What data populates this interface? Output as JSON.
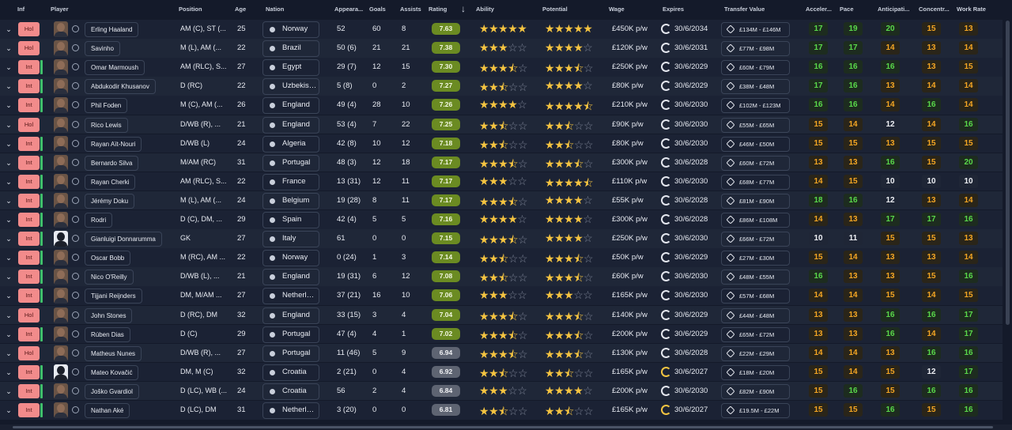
{
  "headers": {
    "inf": "Inf",
    "player": "Player",
    "position": "Position",
    "age": "Age",
    "nation": "Nation",
    "appearances": "Appeara...",
    "goals": "Goals",
    "assists": "Assists",
    "rating": "Rating",
    "sort_icon": "down-arrow-icon",
    "ability": "Ability",
    "potential": "Potential",
    "wage": "Wage",
    "expires": "Expires",
    "transfer_value": "Transfer Value",
    "acceleration": "Acceler...",
    "pace": "Pace",
    "anticipation": "Anticipati...",
    "concentration": "Concentr...",
    "work_rate": "Work Rate"
  },
  "colors": {
    "rating_green": "#6b8b22",
    "rating_grey": "#5e6472",
    "attr_green": "#59d94a",
    "attr_lime": "#a4e04b",
    "attr_orange": "#f5a623",
    "inf_badge": "#f28b8b",
    "star": "#f5c441"
  },
  "players": [
    {
      "inf": "Hol",
      "name": "Erling Haaland",
      "position": "AM (C), ST (...",
      "age": "25",
      "nation": "Norway",
      "apps": "52",
      "goals": "60",
      "assists": "8",
      "rating": "7.63",
      "rating_style": "green",
      "ability": 5,
      "potential": 5,
      "wage": "£450K p/w",
      "expires": "30/6/2034",
      "expiry_warn": false,
      "transfer_value": "£134M - £146M",
      "accel": "17",
      "pace": "19",
      "antic": "20",
      "conc": "15",
      "work": "13"
    },
    {
      "inf": "Hol",
      "name": "Savinho",
      "position": "M (L), AM (...",
      "age": "22",
      "nation": "Brazil",
      "apps": "50 (6)",
      "goals": "21",
      "assists": "21",
      "rating": "7.38",
      "rating_style": "green",
      "ability": 3,
      "potential": 4,
      "wage": "£120K p/w",
      "expires": "30/6/2031",
      "expiry_warn": false,
      "transfer_value": "£77M - £98M",
      "accel": "17",
      "pace": "17",
      "antic": "14",
      "conc": "13",
      "work": "14"
    },
    {
      "inf": "Int",
      "name": "Omar Marmoush",
      "position": "AM (RLC), S...",
      "age": "27",
      "nation": "Egypt",
      "apps": "29 (7)",
      "goals": "12",
      "assists": "15",
      "rating": "7.30",
      "rating_style": "green",
      "ability": 3.5,
      "potential": 3.5,
      "wage": "£250K p/w",
      "expires": "30/6/2029",
      "expiry_warn": false,
      "transfer_value": "£60M - £79M",
      "accel": "16",
      "pace": "16",
      "antic": "16",
      "conc": "13",
      "work": "15"
    },
    {
      "inf": "Int",
      "name": "Abdukodir Khusanov",
      "position": "D (RC)",
      "age": "22",
      "nation": "Uzbekistan",
      "apps": "5 (8)",
      "goals": "0",
      "assists": "2",
      "rating": "7.27",
      "rating_style": "green",
      "ability": 2.5,
      "potential": 4,
      "wage": "£80K p/w",
      "expires": "30/6/2029",
      "expiry_warn": false,
      "transfer_value": "£38M - £48M",
      "accel": "17",
      "pace": "16",
      "antic": "13",
      "conc": "14",
      "work": "14"
    },
    {
      "inf": "Int",
      "name": "Phil Foden",
      "position": "M (C), AM (...",
      "age": "26",
      "nation": "England",
      "apps": "49 (4)",
      "goals": "28",
      "assists": "10",
      "rating": "7.26",
      "rating_style": "green",
      "ability": 4,
      "potential": 4.5,
      "wage": "£210K p/w",
      "expires": "30/6/2030",
      "expiry_warn": false,
      "transfer_value": "£102M - £123M",
      "accel": "16",
      "pace": "16",
      "antic": "14",
      "conc": "16",
      "work": "14"
    },
    {
      "inf": "Hol",
      "name": "Rico Lewis",
      "position": "D/WB (R), ...",
      "age": "21",
      "nation": "England",
      "apps": "53 (4)",
      "goals": "7",
      "assists": "22",
      "rating": "7.25",
      "rating_style": "green",
      "ability": 2.5,
      "potential": 2.5,
      "wage": "£90K p/w",
      "expires": "30/6/2030",
      "expiry_warn": false,
      "transfer_value": "£55M - £65M",
      "accel": "15",
      "pace": "14",
      "antic": "12",
      "conc": "14",
      "work": "16"
    },
    {
      "inf": "Int",
      "name": "Rayan Aït-Nouri",
      "position": "D/WB (L)",
      "age": "24",
      "nation": "Algeria",
      "apps": "42 (8)",
      "goals": "10",
      "assists": "12",
      "rating": "7.18",
      "rating_style": "green",
      "ability": 2.5,
      "potential": 2.5,
      "wage": "£80K p/w",
      "expires": "30/6/2030",
      "expiry_warn": false,
      "transfer_value": "£46M - £50M",
      "accel": "15",
      "pace": "15",
      "antic": "13",
      "conc": "15",
      "work": "15"
    },
    {
      "inf": "Int",
      "name": "Bernardo Silva",
      "position": "M/AM (RC)",
      "age": "31",
      "nation": "Portugal",
      "apps": "48 (3)",
      "goals": "12",
      "assists": "18",
      "rating": "7.17",
      "rating_style": "green",
      "ability": 3.5,
      "potential": 3.5,
      "wage": "£300K p/w",
      "expires": "30/6/2028",
      "expiry_warn": false,
      "transfer_value": "£60M - £72M",
      "accel": "13",
      "pace": "13",
      "antic": "16",
      "conc": "15",
      "work": "20"
    },
    {
      "inf": "Int",
      "name": "Rayan Cherki",
      "position": "AM (RLC), S...",
      "age": "22",
      "nation": "France",
      "apps": "13 (31)",
      "goals": "12",
      "assists": "11",
      "rating": "7.17",
      "rating_style": "green",
      "ability": 3,
      "potential": 4.5,
      "wage": "£110K p/w",
      "expires": "30/6/2030",
      "expiry_warn": false,
      "transfer_value": "£68M - £77M",
      "accel": "14",
      "pace": "15",
      "antic": "10",
      "conc": "10",
      "work": "10"
    },
    {
      "inf": "Int",
      "name": "Jérémy Doku",
      "position": "M (L), AM (...",
      "age": "24",
      "nation": "Belgium",
      "apps": "19 (28)",
      "goals": "8",
      "assists": "11",
      "rating": "7.17",
      "rating_style": "green",
      "ability": 3.5,
      "potential": 4,
      "wage": "£55K p/w",
      "expires": "30/6/2028",
      "expiry_warn": false,
      "transfer_value": "£81M - £90M",
      "accel": "18",
      "pace": "16",
      "antic": "12",
      "conc": "13",
      "work": "14"
    },
    {
      "inf": "Int",
      "name": "Rodri",
      "position": "D (C), DM, ...",
      "age": "29",
      "nation": "Spain",
      "apps": "42 (4)",
      "goals": "5",
      "assists": "5",
      "rating": "7.16",
      "rating_style": "green",
      "ability": 4,
      "potential": 4,
      "wage": "£300K p/w",
      "expires": "30/6/2028",
      "expiry_warn": false,
      "transfer_value": "£86M - £108M",
      "accel": "14",
      "pace": "13",
      "antic": "17",
      "conc": "17",
      "work": "16"
    },
    {
      "inf": "Int",
      "name": "Gianluigi Donnarumma",
      "position": "GK",
      "age": "27",
      "nation": "Italy",
      "apps": "61",
      "goals": "0",
      "assists": "0",
      "rating": "7.15",
      "rating_style": "green",
      "ability": 3.5,
      "potential": 4,
      "wage": "£250K p/w",
      "expires": "30/6/2030",
      "expiry_warn": false,
      "transfer_value": "£66M - £72M",
      "accel": "10",
      "pace": "11",
      "antic": "15",
      "conc": "15",
      "work": "13"
    },
    {
      "inf": "Int",
      "name": "Oscar Bobb",
      "position": "M (RC), AM ...",
      "age": "22",
      "nation": "Norway",
      "apps": "0 (24)",
      "goals": "1",
      "assists": "3",
      "rating": "7.14",
      "rating_style": "green",
      "ability": 2.5,
      "potential": 3.5,
      "wage": "£50K p/w",
      "expires": "30/6/2029",
      "expiry_warn": false,
      "transfer_value": "£27M - £30M",
      "accel": "15",
      "pace": "14",
      "antic": "13",
      "conc": "13",
      "work": "14"
    },
    {
      "inf": "Int",
      "name": "Nico O'Reilly",
      "position": "D/WB (L), ...",
      "age": "21",
      "nation": "England",
      "apps": "19 (31)",
      "goals": "6",
      "assists": "12",
      "rating": "7.08",
      "rating_style": "green",
      "ability": 2.5,
      "potential": 3.5,
      "wage": "£60K p/w",
      "expires": "30/6/2030",
      "expiry_warn": false,
      "transfer_value": "£48M - £55M",
      "accel": "16",
      "pace": "13",
      "antic": "13",
      "conc": "15",
      "work": "16"
    },
    {
      "inf": "Int",
      "name": "Tijjani Reijnders",
      "position": "DM, M/AM ...",
      "age": "27",
      "nation": "Netherlan...",
      "apps": "37 (21)",
      "goals": "16",
      "assists": "10",
      "rating": "7.06",
      "rating_style": "green",
      "ability": 3,
      "potential": 3,
      "wage": "£165K p/w",
      "expires": "30/6/2030",
      "expiry_warn": false,
      "transfer_value": "£57M - £68M",
      "accel": "14",
      "pace": "14",
      "antic": "15",
      "conc": "14",
      "work": "15"
    },
    {
      "inf": "Hol",
      "name": "John Stones",
      "position": "D (RC), DM",
      "age": "32",
      "nation": "England",
      "apps": "33 (15)",
      "goals": "3",
      "assists": "4",
      "rating": "7.04",
      "rating_style": "green",
      "ability": 3.5,
      "potential": 3.5,
      "wage": "£140K p/w",
      "expires": "30/6/2029",
      "expiry_warn": false,
      "transfer_value": "£44M - £48M",
      "accel": "13",
      "pace": "13",
      "antic": "16",
      "conc": "16",
      "work": "17"
    },
    {
      "inf": "Int",
      "name": "Rúben Dias",
      "position": "D (C)",
      "age": "29",
      "nation": "Portugal",
      "apps": "47 (4)",
      "goals": "4",
      "assists": "1",
      "rating": "7.02",
      "rating_style": "green",
      "ability": 3.5,
      "potential": 3.5,
      "wage": "£200K p/w",
      "expires": "30/6/2029",
      "expiry_warn": false,
      "transfer_value": "£65M - £72M",
      "accel": "13",
      "pace": "13",
      "antic": "16",
      "conc": "14",
      "work": "17"
    },
    {
      "inf": "Hol",
      "name": "Matheus Nunes",
      "position": "D/WB (R), ...",
      "age": "27",
      "nation": "Portugal",
      "apps": "11 (46)",
      "goals": "5",
      "assists": "9",
      "rating": "6.94",
      "rating_style": "grey",
      "ability": 3.5,
      "potential": 3.5,
      "wage": "£130K p/w",
      "expires": "30/6/2028",
      "expiry_warn": false,
      "transfer_value": "£22M - £29M",
      "accel": "14",
      "pace": "14",
      "antic": "13",
      "conc": "16",
      "work": "16"
    },
    {
      "inf": "Int",
      "name": "Mateo Kovačić",
      "position": "DM, M (C)",
      "age": "32",
      "nation": "Croatia",
      "apps": "2 (21)",
      "goals": "0",
      "assists": "4",
      "rating": "6.92",
      "rating_style": "grey",
      "ability": 2.5,
      "potential": 2.5,
      "wage": "£165K p/w",
      "expires": "30/6/2027",
      "expiry_warn": true,
      "transfer_value": "£18M - £20M",
      "accel": "15",
      "pace": "14",
      "antic": "15",
      "conc": "12",
      "work": "17"
    },
    {
      "inf": "Int",
      "name": "Joško Gvardiol",
      "position": "D (LC), WB (...",
      "age": "24",
      "nation": "Croatia",
      "apps": "56",
      "goals": "2",
      "assists": "4",
      "rating": "6.84",
      "rating_style": "grey",
      "ability": 3,
      "potential": 4,
      "wage": "£200K p/w",
      "expires": "30/6/2030",
      "expiry_warn": false,
      "transfer_value": "£82M - £90M",
      "accel": "15",
      "pace": "16",
      "antic": "15",
      "conc": "16",
      "work": "16"
    },
    {
      "inf": "Int",
      "name": "Nathan Aké",
      "position": "D (LC), DM",
      "age": "31",
      "nation": "Netherlan...",
      "apps": "3 (20)",
      "goals": "0",
      "assists": "0",
      "rating": "6.81",
      "rating_style": "grey",
      "ability": 2.5,
      "potential": 2.5,
      "wage": "£165K p/w",
      "expires": "30/6/2027",
      "expiry_warn": true,
      "transfer_value": "£19.5M - £22M",
      "accel": "15",
      "pace": "15",
      "antic": "16",
      "conc": "15",
      "work": "16"
    }
  ]
}
